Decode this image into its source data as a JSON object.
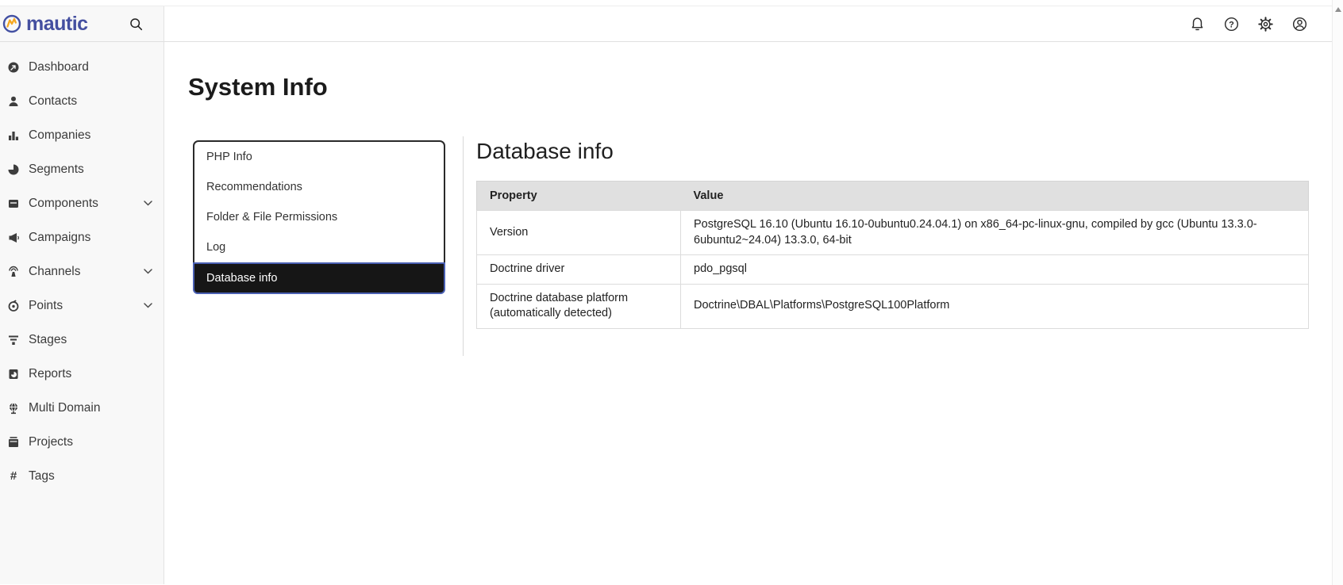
{
  "brand": {
    "name": "mautic"
  },
  "header": {
    "icons": [
      "search-icon",
      "notifications-icon",
      "help-icon",
      "settings-icon",
      "account-icon"
    ]
  },
  "sidebar": {
    "items": [
      {
        "label": "Dashboard",
        "icon": "dashboard-icon",
        "expandable": false
      },
      {
        "label": "Contacts",
        "icon": "contacts-icon",
        "expandable": false
      },
      {
        "label": "Companies",
        "icon": "companies-icon",
        "expandable": false
      },
      {
        "label": "Segments",
        "icon": "segments-icon",
        "expandable": false
      },
      {
        "label": "Components",
        "icon": "components-icon",
        "expandable": true
      },
      {
        "label": "Campaigns",
        "icon": "campaigns-icon",
        "expandable": false
      },
      {
        "label": "Channels",
        "icon": "channels-icon",
        "expandable": true
      },
      {
        "label": "Points",
        "icon": "points-icon",
        "expandable": true
      },
      {
        "label": "Stages",
        "icon": "stages-icon",
        "expandable": false
      },
      {
        "label": "Reports",
        "icon": "reports-icon",
        "expandable": false
      },
      {
        "label": "Multi Domain",
        "icon": "multi-domain-icon",
        "expandable": false
      },
      {
        "label": "Projects",
        "icon": "projects-icon",
        "expandable": false
      },
      {
        "label": "Tags",
        "icon": "tags-icon",
        "expandable": false
      }
    ]
  },
  "page": {
    "title": "System Info"
  },
  "tabs": {
    "items": [
      "PHP Info",
      "Recommendations",
      "Folder & File Permissions",
      "Log",
      "Database info"
    ],
    "selected": "Database info"
  },
  "section": {
    "title": "Database info"
  },
  "table": {
    "columns": {
      "property": "Property",
      "value": "Value"
    },
    "rows": [
      {
        "property": "Version",
        "value": "PostgreSQL 16.10 (Ubuntu 16.10-0ubuntu0.24.04.1) on x86_64-pc-linux-gnu, compiled by gcc (Ubuntu 13.3.0-6ubuntu2~24.04) 13.3.0, 64-bit"
      },
      {
        "property": "Doctrine driver",
        "value": "pdo_pgsql"
      },
      {
        "property": "Doctrine database platform (automatically detected)",
        "value": "Doctrine\\DBAL\\Platforms\\PostgreSQL100Platform"
      }
    ]
  },
  "colors": {
    "brand_blue": "#444fa0",
    "brand_orange": "#f6a821",
    "accent_blue": "#4a60b3",
    "selected_tab_bg": "#161616",
    "table_header_bg": "#e0e0e0",
    "sidebar_bg": "#f8f8f8"
  }
}
